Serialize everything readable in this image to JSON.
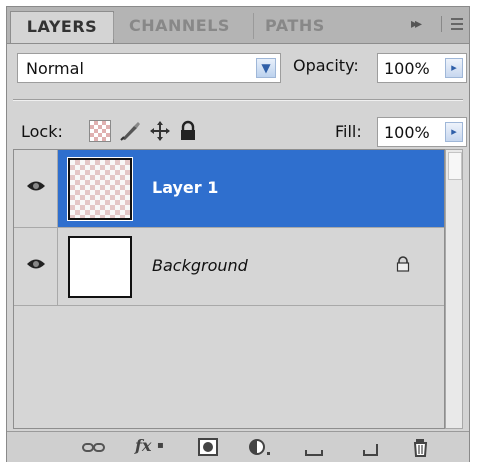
{
  "tabs": {
    "layers": "LAYERS",
    "channels": "CHANNELS",
    "paths": "PATHS",
    "collapse_icon": "double-arrow-icon",
    "menu_icon": "panel-menu-icon"
  },
  "blend": {
    "value": "Normal"
  },
  "opacity": {
    "label": "Opacity:",
    "value": "100%"
  },
  "lock": {
    "label": "Lock:",
    "icons": [
      "lock-transparent-icon",
      "lock-image-icon",
      "lock-position-icon",
      "lock-all-icon"
    ]
  },
  "fill": {
    "label": "Fill:",
    "value": "100%"
  },
  "layers": [
    {
      "name": "Layer 1",
      "selected": true,
      "visible": true,
      "thumbnail": "transparent",
      "locked": false
    },
    {
      "name": "Background",
      "selected": false,
      "visible": true,
      "thumbnail": "white",
      "locked": true
    }
  ],
  "toolbar": {
    "icons": [
      "link-layers-icon",
      "fx-icon",
      "mask-icon",
      "adjustment-layer-icon",
      "group-folder-icon",
      "new-layer-icon",
      "trash-icon"
    ],
    "fx_label": "fx"
  },
  "colors": {
    "selection": "#2f6fce",
    "panel": "#d4d4d4"
  }
}
